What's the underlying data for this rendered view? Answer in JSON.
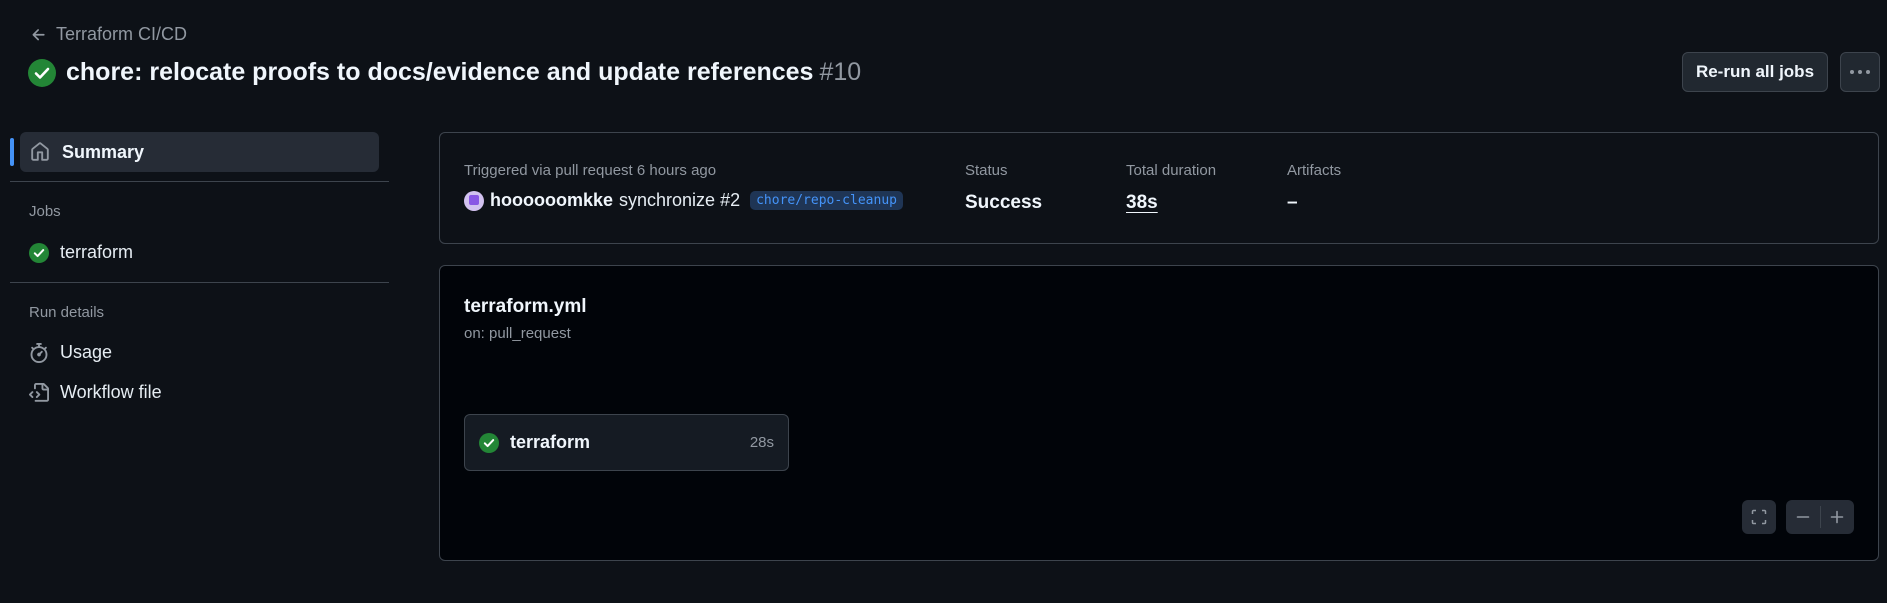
{
  "header": {
    "back_link": "Terraform CI/CD",
    "title": "chore: relocate proofs to docs/evidence and update references",
    "run_number": "#10",
    "rerun_button": "Re-run all jobs",
    "more_button_icon": "kebab-horizontal-icon"
  },
  "sidebar": {
    "summary": "Summary",
    "jobs_heading": "Jobs",
    "jobs": [
      {
        "label": "terraform",
        "status": "success"
      }
    ],
    "run_details_heading": "Run details",
    "details": [
      {
        "label": "Usage",
        "icon": "stopwatch-icon"
      },
      {
        "label": "Workflow file",
        "icon": "file-code-icon"
      }
    ]
  },
  "summary": {
    "trigger_label": "Triggered via pull request 6 hours ago",
    "actor": "hoooooomkke",
    "action": "synchronize #2",
    "branch": "chore/repo-cleanup",
    "status_label": "Status",
    "status_value": "Success",
    "duration_label": "Total duration",
    "duration_value": "38s",
    "artifacts_label": "Artifacts",
    "artifacts_value": "–"
  },
  "graph": {
    "workflow_file": "terraform.yml",
    "trigger": "on: pull_request",
    "job": {
      "name": "terraform",
      "duration": "28s",
      "status": "success"
    }
  },
  "colors": {
    "success": "#238636",
    "accent": "#4493f8",
    "background": "#0d1117"
  }
}
